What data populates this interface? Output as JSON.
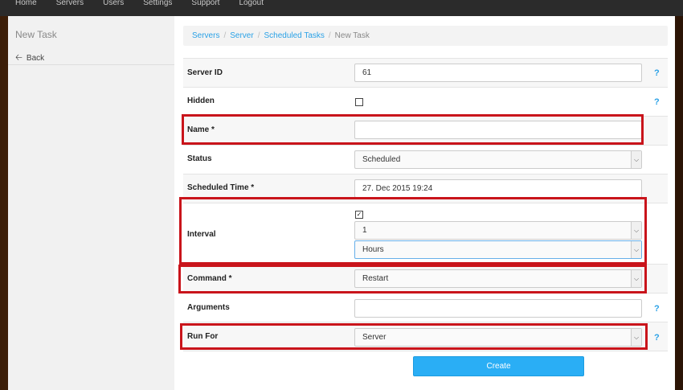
{
  "nav": [
    "Home",
    "Servers",
    "Users",
    "Settings",
    "Support",
    "Logout"
  ],
  "sidebar": {
    "title": "New Task",
    "back_label": "Back"
  },
  "breadcrumb": {
    "items": [
      "Servers",
      "Server",
      "Scheduled Tasks"
    ],
    "current": "New Task"
  },
  "form": {
    "server_id": {
      "label": "Server ID",
      "value": "61"
    },
    "hidden": {
      "label": "Hidden"
    },
    "name": {
      "label": "Name *",
      "value": ""
    },
    "status": {
      "label": "Status",
      "value": "Scheduled"
    },
    "scheduled_time": {
      "label": "Scheduled Time *",
      "value": "27. Dec 2015 19:24"
    },
    "interval": {
      "label": "Interval",
      "amount": "1",
      "unit": "Hours"
    },
    "command": {
      "label": "Command *",
      "value": "Restart"
    },
    "arguments": {
      "label": "Arguments",
      "value": ""
    },
    "run_for": {
      "label": "Run For",
      "value": "Server"
    },
    "help_glyph": "?",
    "create_label": "Create"
  },
  "colors": {
    "accent": "#2aa1e6",
    "highlight": "#c9141b",
    "button": "#2aaef5"
  }
}
